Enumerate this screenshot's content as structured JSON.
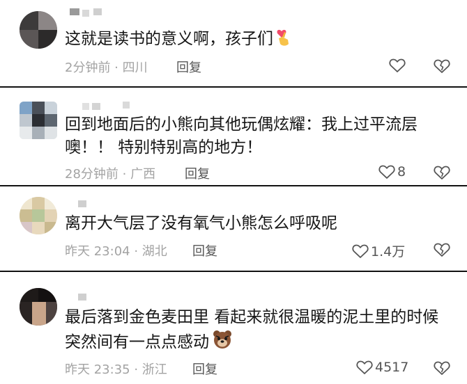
{
  "comments": [
    {
      "text_lines": [
        "这就是读书的意义啊，孩子们"
      ],
      "emoji": "heart-hands-emoji",
      "time": "2分钟前 · 四川",
      "reply": "回复",
      "likes": ""
    },
    {
      "text_lines": [
        "回到地面后的小熊向其他玩偶炫耀：我上过平流层",
        "噢！！ 特别特别高的地方！"
      ],
      "emoji": "",
      "time": "28分钟前 · 广西",
      "reply": "回复",
      "likes": "8"
    },
    {
      "text_lines": [
        "离开大气层了没有氧气小熊怎么呼吸呢"
      ],
      "emoji": "",
      "time": "昨天 23:04 · 湖北",
      "reply": "回复",
      "likes": "1.4万"
    },
    {
      "text_lines": [
        "最后落到金色麦田里 看起来就很温暖的泥土里的时候",
        "突然间有一点点感动"
      ],
      "emoji": "bear-emoji",
      "time": "昨天 23:35 · 浙江",
      "reply": "回复",
      "likes": "4517"
    }
  ],
  "colors": {
    "text": "#161616",
    "meta": "#a3a3a3",
    "icon": "#555555",
    "divider": "#111111"
  }
}
